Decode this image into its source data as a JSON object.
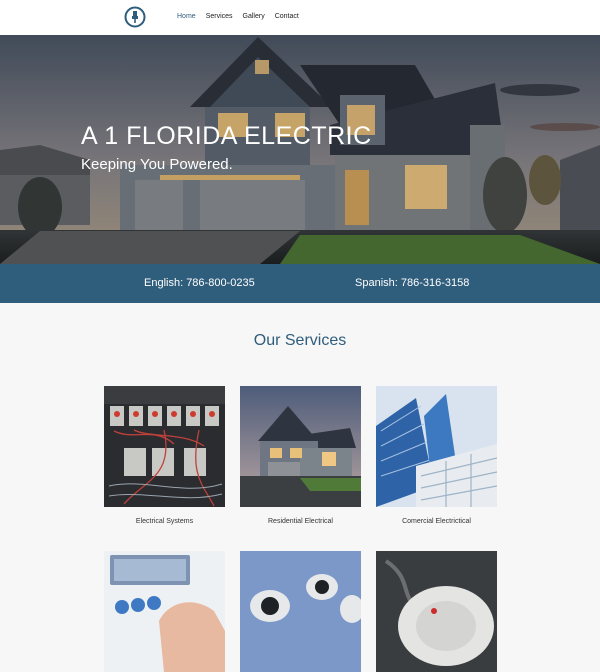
{
  "brand": {
    "logo_icon": "plug-icon",
    "accent": "#2f5d7c"
  },
  "nav": {
    "items": [
      {
        "label": "Home",
        "active": true
      },
      {
        "label": "Services"
      },
      {
        "label": "Gallery"
      },
      {
        "label": "Contact"
      }
    ]
  },
  "hero": {
    "title": "A 1 FLORIDA ELECTRIC",
    "subtitle": "Keeping You Powered."
  },
  "contact": {
    "english": "English: 786-800-0235",
    "spanish": "Spanish: 786-316-3158"
  },
  "services": {
    "title": "Our Services",
    "items": [
      {
        "label": "Electrical Systems"
      },
      {
        "label": "Residential Electrical"
      },
      {
        "label": "Comercial Electrictical"
      }
    ]
  }
}
